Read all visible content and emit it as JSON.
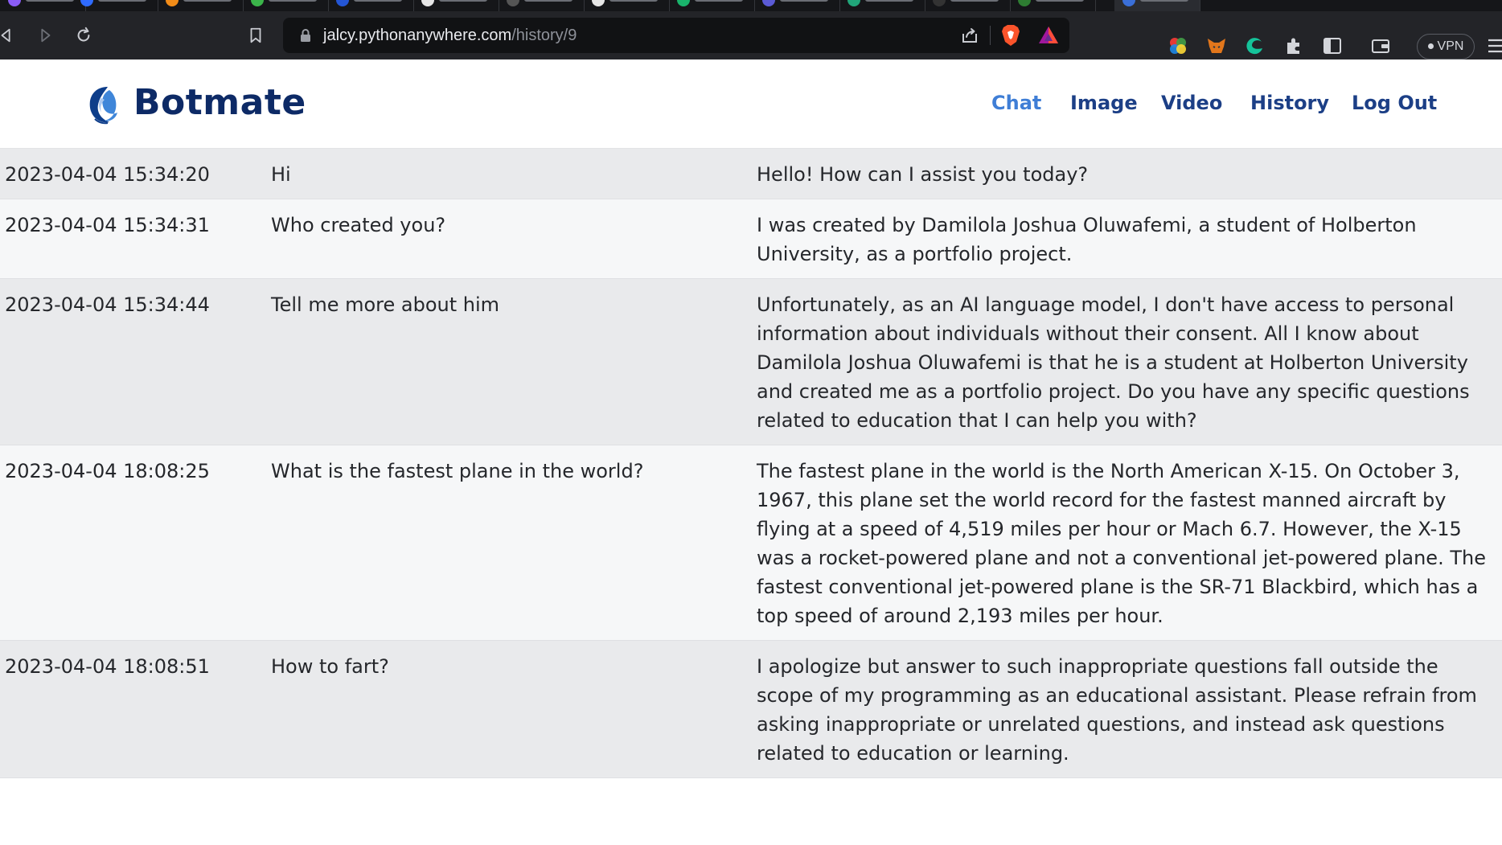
{
  "browser": {
    "url_host": "jalcy.pythonanywhere.com",
    "url_path": "/history/9",
    "vpn_label": "VPN"
  },
  "site": {
    "brand": "Botmate",
    "nav": [
      "Chat",
      "Image",
      "Video",
      "History",
      "Log Out"
    ],
    "active_nav": "Chat",
    "colors": {
      "brand": "#0d2a66",
      "nav": "#1c3f86",
      "nav_active": "#3f7ed6"
    }
  },
  "history": {
    "rows": [
      {
        "time": "2023-04-04 15:34:20",
        "question": "Hi",
        "answer": "Hello! How can I assist you today?"
      },
      {
        "time": "2023-04-04 15:34:31",
        "question": "Who created you?",
        "answer": "I was created by Damilola Joshua Oluwafemi, a student of Holberton University, as a portfolio project."
      },
      {
        "time": "2023-04-04 15:34:44",
        "question": "Tell me more about him",
        "answer": "Unfortunately, as an AI language model, I don't have access to personal information about individuals without their consent. All I know about Damilola Joshua Oluwafemi is that he is a student at Holberton University and created me as a portfolio project. Do you have any specific questions related to education that I can help you with?"
      },
      {
        "time": "2023-04-04 18:08:25",
        "question": "What is the fastest plane in the world?",
        "answer": "The fastest plane in the world is the North American X-15. On October 3, 1967, this plane set the world record for the fastest manned aircraft by flying at a speed of 4,519 miles per hour or Mach 6.7. However, the X-15 was a rocket-powered plane and not a conventional jet-powered plane. The fastest conventional jet-powered plane is the SR-71 Blackbird, which has a top speed of around 2,193 miles per hour."
      },
      {
        "time": "2023-04-04 18:08:51",
        "question": "How to fart?",
        "answer": "I apologize but answer to such inappropriate questions fall outside the scope of my programming as an educational assistant. Please refrain from asking inappropriate or unrelated questions, and instead ask questions related to education or learning."
      }
    ]
  }
}
